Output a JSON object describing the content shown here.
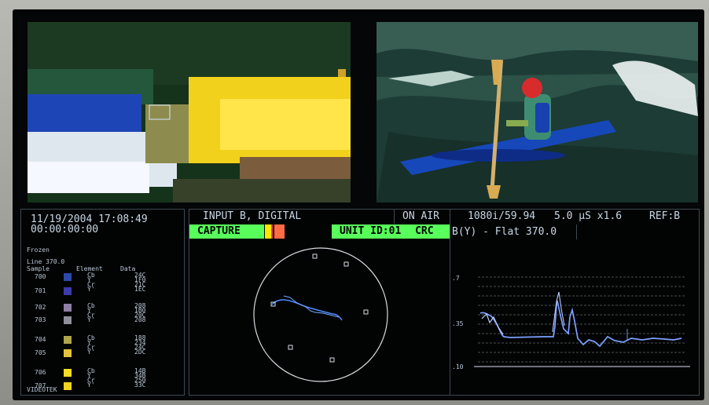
{
  "header": {
    "datetime": "11/19/2004 17:08:49",
    "timecode": "00:00:00:00",
    "input": "INPUT B, DIGITAL",
    "onair": "ON AIR",
    "format": "1080i/59.94",
    "time": "5.0 µS x1.6",
    "ref": "REF:B",
    "capture": "CAPTURE",
    "unit": "UNIT ID:01",
    "crc": "CRC",
    "wave_label": "B(Y) - Flat 370.0"
  },
  "panel": {
    "frozen": "Frozen",
    "line": "Line 370.0",
    "col_sample": "Sample",
    "col_element": "Element",
    "col_data": "Data",
    "footer": "VIDEOTEK"
  },
  "samples": [
    {
      "sample": "700",
      "color": "#2d49a8",
      "elements": [
        "Cb",
        "Y",
        "Cr",
        "Y'"
      ],
      "data": [
        "24C",
        "1F0",
        "21C",
        "1EC"
      ]
    },
    {
      "sample": "701",
      "color": "#3d3ba7",
      "elements": [
        "",
        "",
        "",
        ""
      ],
      "data": [
        "",
        "",
        "",
        ""
      ]
    },
    {
      "sample": "702",
      "color": "#8e7fa5",
      "elements": [
        "Cb",
        "Y",
        "Cr",
        "Y'"
      ],
      "data": [
        "208",
        "1B0",
        "20C",
        "208"
      ]
    },
    {
      "sample": "703",
      "color": "#8d8f9a",
      "elements": [
        "",
        "",
        "",
        ""
      ],
      "data": [
        "",
        "",
        "",
        ""
      ]
    },
    {
      "sample": "704",
      "color": "#b0a54a",
      "elements": [
        "Cb",
        "Y",
        "Cr",
        "Y'"
      ],
      "data": [
        "188",
        "234",
        "24C",
        "2DC"
      ]
    },
    {
      "sample": "705",
      "color": "#e3c33c",
      "elements": [
        "",
        "",
        "",
        ""
      ],
      "data": [
        "",
        "",
        "",
        ""
      ]
    },
    {
      "sample": "706",
      "color": "#f5dc22",
      "elements": [
        "Cb",
        "Y",
        "Cr",
        "Y'"
      ],
      "data": [
        "14B",
        "34B",
        "250",
        "33C"
      ]
    },
    {
      "sample": "707",
      "color": "#f3d31e",
      "elements": [
        "",
        "",
        "",
        ""
      ],
      "data": [
        "",
        "",
        "",
        ""
      ]
    }
  ],
  "waveform": {
    "labels": [
      ".7",
      ".35",
      ".10"
    ]
  }
}
